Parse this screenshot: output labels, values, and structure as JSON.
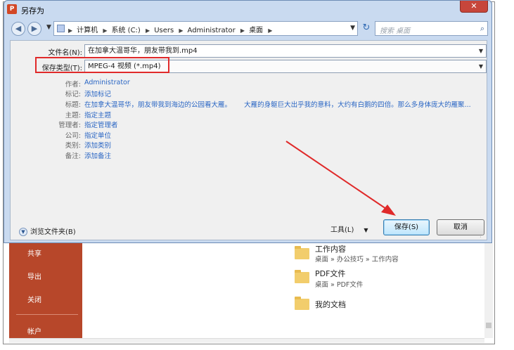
{
  "dialog": {
    "title": "另存为",
    "app_icon_text": "P",
    "close_label": "✕"
  },
  "nav": {
    "back_glyph": "◀",
    "forward_glyph": "▶",
    "recent_glyph": "▼",
    "breadcrumbs": [
      "计算机",
      "系统 (C:)",
      "Users",
      "Administrator",
      "桌面"
    ],
    "refresh_glyph": "↻",
    "search_placeholder": "搜索 桌面"
  },
  "form": {
    "filename_label": "文件名(N):",
    "filename_value": "在加拿大温哥华，朋友带我到.mp4",
    "type_label": "保存类型(T):",
    "type_value": "MPEG-4 视频 (*.mp4)"
  },
  "metadata": [
    {
      "label": "作者:",
      "value": "Administrator"
    },
    {
      "label": "标记:",
      "value": "添加标记"
    },
    {
      "label": "标题:",
      "value": "在加拿大温哥华，朋友带我到海边的公园看大雁。      大雁的身躯巨大出乎我的意料，大约有白鹅的四倍。那么多身体庞大的雁聚..."
    },
    {
      "label": "主题:",
      "value": "指定主题"
    },
    {
      "label": "管理者:",
      "value": "指定管理者"
    },
    {
      "label": "公司:",
      "value": "指定单位"
    },
    {
      "label": "类别:",
      "value": "添加类别"
    },
    {
      "label": "备注:",
      "value": "添加备注"
    }
  ],
  "footer": {
    "browse_label": "浏览文件夹(B)",
    "tools_label": "工具(L)",
    "save_label": "保存(S)",
    "cancel_label": "取消"
  },
  "backstage": {
    "nav_items": [
      "共享",
      "导出",
      "关闭",
      "帐户"
    ],
    "recent": [
      {
        "title": "工作内容",
        "path": "桌面 » 办公技巧 » 工作内容"
      },
      {
        "title": "PDF文件",
        "path": "桌面 » PDF文件"
      },
      {
        "title": "我的文档",
        "path": ""
      }
    ]
  },
  "colors": {
    "highlight_red": "#e02a2a",
    "backstage_accent": "#b7472a",
    "link_blue": "#2a66c4"
  }
}
